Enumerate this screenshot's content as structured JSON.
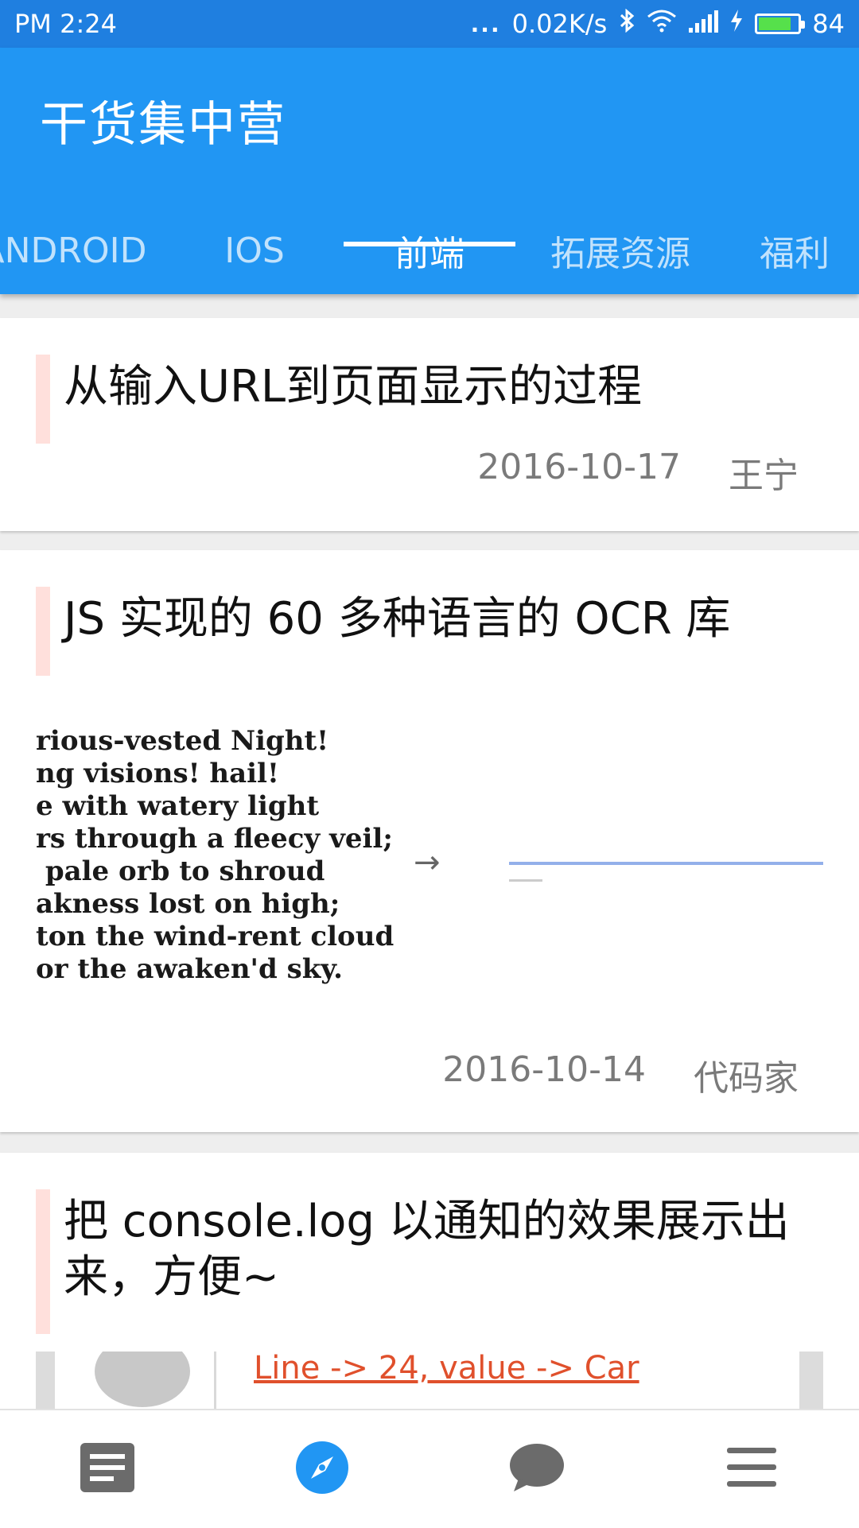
{
  "status_bar": {
    "time": "PM  2:24",
    "dots": "...",
    "network_speed": "0.02K/s",
    "battery_level": "84",
    "battery_fraction": 0.84,
    "battery_color": "#56e04b",
    "icons": [
      "bluetooth-icon",
      "wifi-icon",
      "signal-icon",
      "charging-icon",
      "battery-icon"
    ]
  },
  "app_bar": {
    "title": "干货集中营",
    "color": "#2196f3"
  },
  "tabs": [
    {
      "label": "ANDROID",
      "active": false
    },
    {
      "label": "IOS",
      "active": false
    },
    {
      "label": "前端",
      "active": true
    },
    {
      "label": "拓展资源",
      "active": false
    },
    {
      "label": "福利",
      "active": false
    }
  ],
  "articles": [
    {
      "title": "从输入URL到页面显示的过程",
      "date": "2016-10-17",
      "author": "王宁"
    },
    {
      "title": "JS 实现的 60 多种语言的 OCR 库",
      "image_lines": "rious-vested Night!\nng visions! hail!\ne with watery light\nrs through a fleecy veil;\n pale orb to shroud\nakness lost on high;\nton the wind-rent cloud\nor the awaken'd sky.",
      "image_arrow": "→",
      "date": "2016-10-14",
      "author": "代码家"
    },
    {
      "title": "把 console.log 以通知的效果展示出来，方便~",
      "image_text": "Line -> 24, value -> Car"
    }
  ],
  "bottom_nav": [
    {
      "icon": "article-icon",
      "active": false
    },
    {
      "icon": "compass-icon",
      "active": true
    },
    {
      "icon": "chat-icon",
      "active": false
    },
    {
      "icon": "menu-icon",
      "active": false
    }
  ],
  "colors": {
    "accent_blue": "#2196f3",
    "status_bar": "#1f7fe0",
    "card_accent": "#ffe0dc",
    "inactive_icon": "#6b6b6b"
  }
}
